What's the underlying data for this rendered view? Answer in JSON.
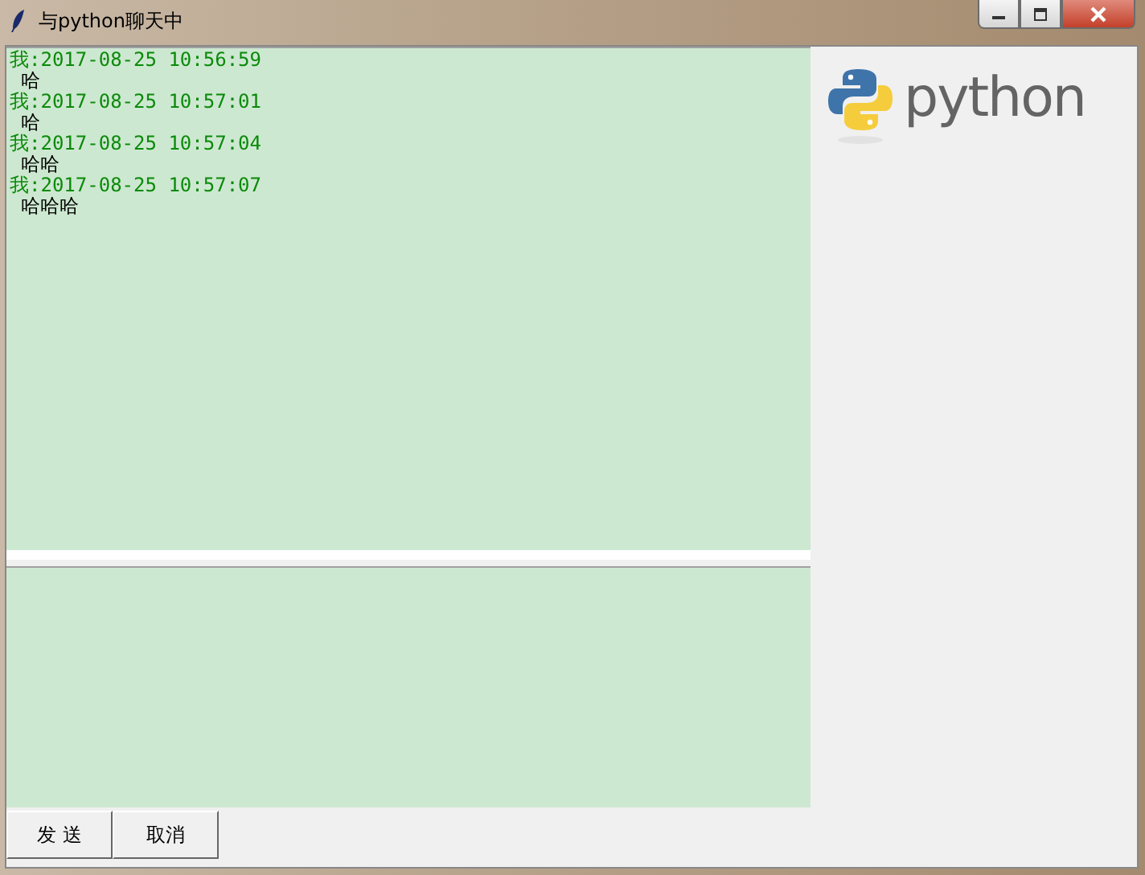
{
  "window": {
    "title": "与python聊天中"
  },
  "messages": [
    {
      "header": "我:2017-08-25 10:56:59",
      "body": "哈"
    },
    {
      "header": "我:2017-08-25 10:57:01",
      "body": "哈"
    },
    {
      "header": "我:2017-08-25 10:57:04",
      "body": "哈哈"
    },
    {
      "header": "我:2017-08-25 10:57:07",
      "body": "哈哈哈"
    }
  ],
  "logo": {
    "text": "python"
  },
  "buttons": [
    "发 送",
    "取消"
  ]
}
